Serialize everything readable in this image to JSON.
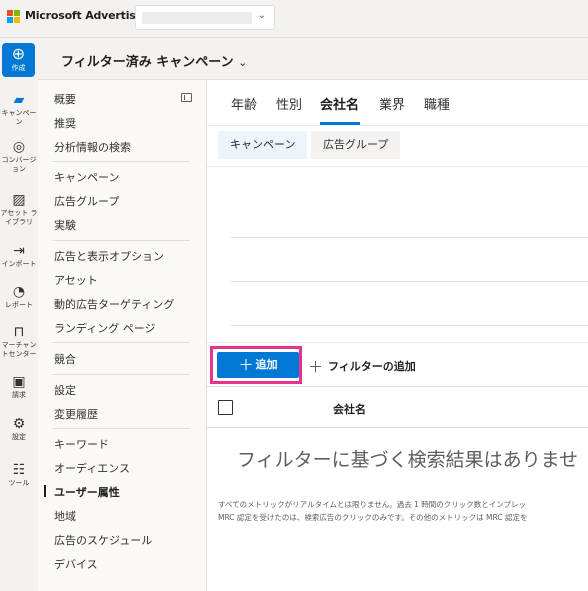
{
  "topbar": {
    "brand": "Microsoft Advertising",
    "account_select_value": ""
  },
  "rail": {
    "create": "作成",
    "items": [
      {
        "label": "キャンペーン",
        "icon": "megaphone-icon"
      },
      {
        "label": "コンバージョン",
        "icon": "target-icon"
      },
      {
        "label": "アセット ライブラリ",
        "icon": "asset-library-icon"
      },
      {
        "label": "インポート",
        "icon": "import-icon"
      },
      {
        "label": "レポート",
        "icon": "report-icon"
      },
      {
        "label": "マーチャントセンター",
        "icon": "shopping-bag-icon"
      },
      {
        "label": "請求",
        "icon": "wallet-icon"
      },
      {
        "label": "設定",
        "icon": "gear-icon"
      },
      {
        "label": "ツール",
        "icon": "tools-icon"
      }
    ]
  },
  "header": {
    "title": "フィルター済み キャンペーン"
  },
  "nav": {
    "items": [
      "概要",
      "推奨",
      "分析情報の検索",
      "キャンペーン",
      "広告グループ",
      "実験",
      "広告と表示オプション",
      "アセット",
      "動的広告ターゲティング",
      "ランディング ページ",
      "競合",
      "設定",
      "変更履歴",
      "キーワード",
      "オーディエンス",
      "ユーザー属性",
      "地域",
      "広告のスケジュール",
      "デバイス"
    ],
    "active": "ユーザー属性"
  },
  "tabs": [
    "年齢",
    "性別",
    "会社名",
    "業界",
    "職種"
  ],
  "active_tab": "会社名",
  "subtabs": [
    "キャンペーン",
    "広告グループ"
  ],
  "active_subtab": "キャンペーン",
  "toolbar": {
    "add_label": "追加",
    "filter_label": "フィルターの追加"
  },
  "table": {
    "columns": [
      "会社名"
    ]
  },
  "empty_message": "フィルターに基づく検索結果はありませ",
  "footnotes": [
    "すべてのメトリックがリアルタイムとは限りません。過去 1 時間のクリック数とインプレッ",
    "MRC 認定を受けたのは、検索広告のクリックのみです。その他のメトリックは MRC 認定を"
  ],
  "colors": {
    "accent": "#0078d4",
    "highlight": "#e3358f"
  }
}
